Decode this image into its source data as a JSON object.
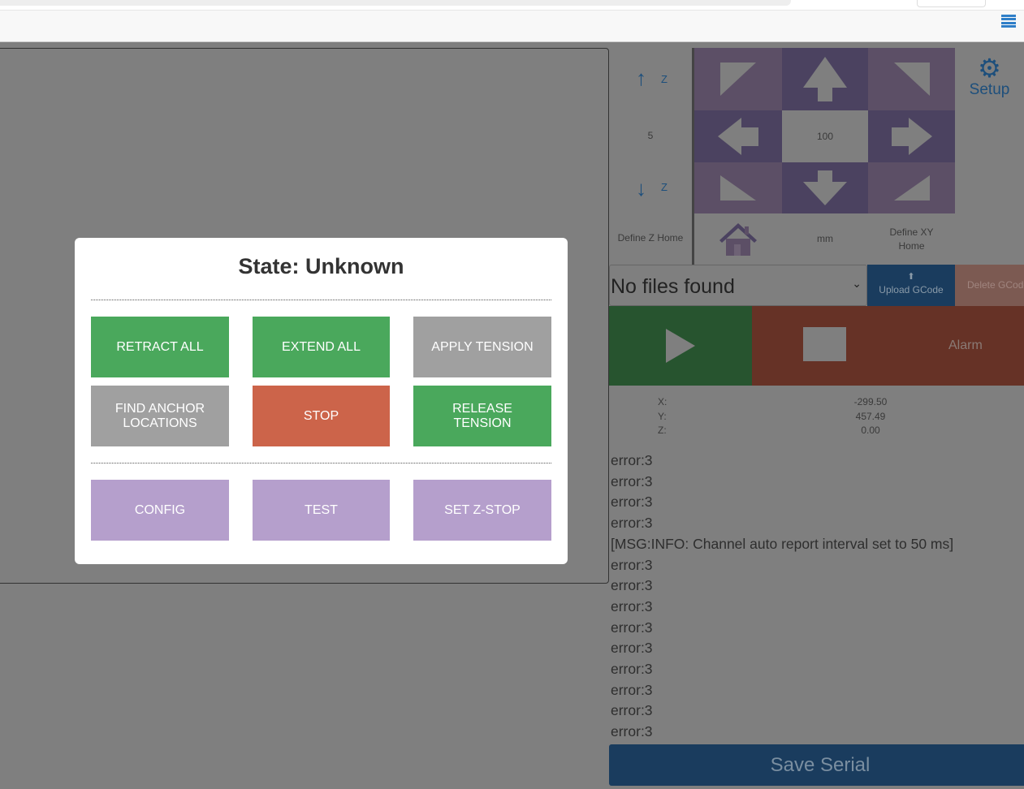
{
  "navbar": {
    "menu_icon": "hamburger-icon"
  },
  "jog": {
    "z_label": "Z",
    "z_step": "5",
    "xy_step": "100",
    "unit": "mm",
    "define_z_home": "Define Z Home",
    "define_xy_home": "Define XY Home"
  },
  "setup": {
    "label": "Setup"
  },
  "files": {
    "selected": "No files found",
    "upload_label": "Upload GCode",
    "delete_label": "Delete GCode"
  },
  "status": {
    "state": "Alarm"
  },
  "position": {
    "x_label": "X:",
    "y_label": "Y:",
    "z_label": "Z:",
    "x": "-299.50",
    "y": "457.49",
    "z": "0.00"
  },
  "log": [
    "error:3",
    "error:3",
    "error:3",
    "error:3",
    "[MSG:INFO: Channel auto report interval set to 50 ms]",
    "error:3",
    "error:3",
    "error:3",
    "error:3",
    "error:3",
    "error:3",
    "error:3",
    "error:3",
    "error:3"
  ],
  "save_serial": "Save Serial",
  "modal": {
    "title": "State: Unknown",
    "buttons": {
      "retract_all": "RETRACT ALL",
      "extend_all": "EXTEND ALL",
      "apply_tension": "APPLY TENSION",
      "find_anchor": "FIND ANCHOR LOCATIONS",
      "stop": "STOP",
      "release_tension": "RELEASE TENSION",
      "config": "CONFIG",
      "test": "TEST",
      "set_z_stop": "SET Z-STOP"
    }
  }
}
